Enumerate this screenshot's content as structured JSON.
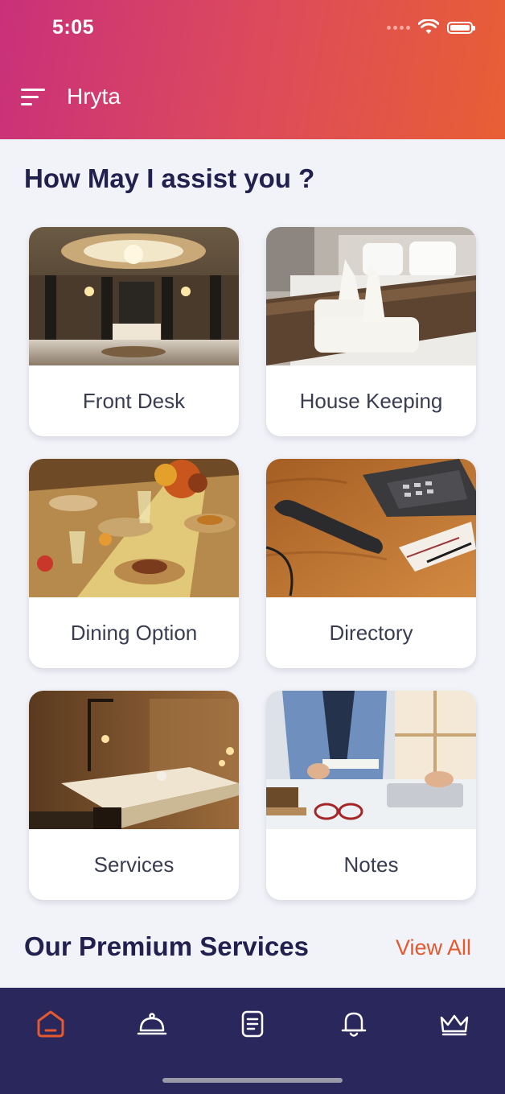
{
  "status_bar": {
    "time": "5:05"
  },
  "header": {
    "title": "Hryta"
  },
  "assist": {
    "title": "How May I assist you ?",
    "cards": [
      {
        "label": "Front Desk"
      },
      {
        "label": "House Keeping"
      },
      {
        "label": "Dining Option"
      },
      {
        "label": "Directory"
      },
      {
        "label": "Services"
      },
      {
        "label": "Notes"
      }
    ]
  },
  "premium": {
    "title": "Our Premium Services",
    "view_all": "View All"
  },
  "tabbar": {
    "tabs": [
      {
        "icon": "home-icon",
        "active": true
      },
      {
        "icon": "room-service-icon",
        "active": false
      },
      {
        "icon": "notes-icon",
        "active": false
      },
      {
        "icon": "bell-icon",
        "active": false
      },
      {
        "icon": "crown-icon",
        "active": false
      }
    ]
  },
  "colors": {
    "accent": "#e4592f",
    "navy": "#29275c",
    "heading": "#22204f",
    "header_start": "#c9307a",
    "header_end": "#e85f34"
  }
}
